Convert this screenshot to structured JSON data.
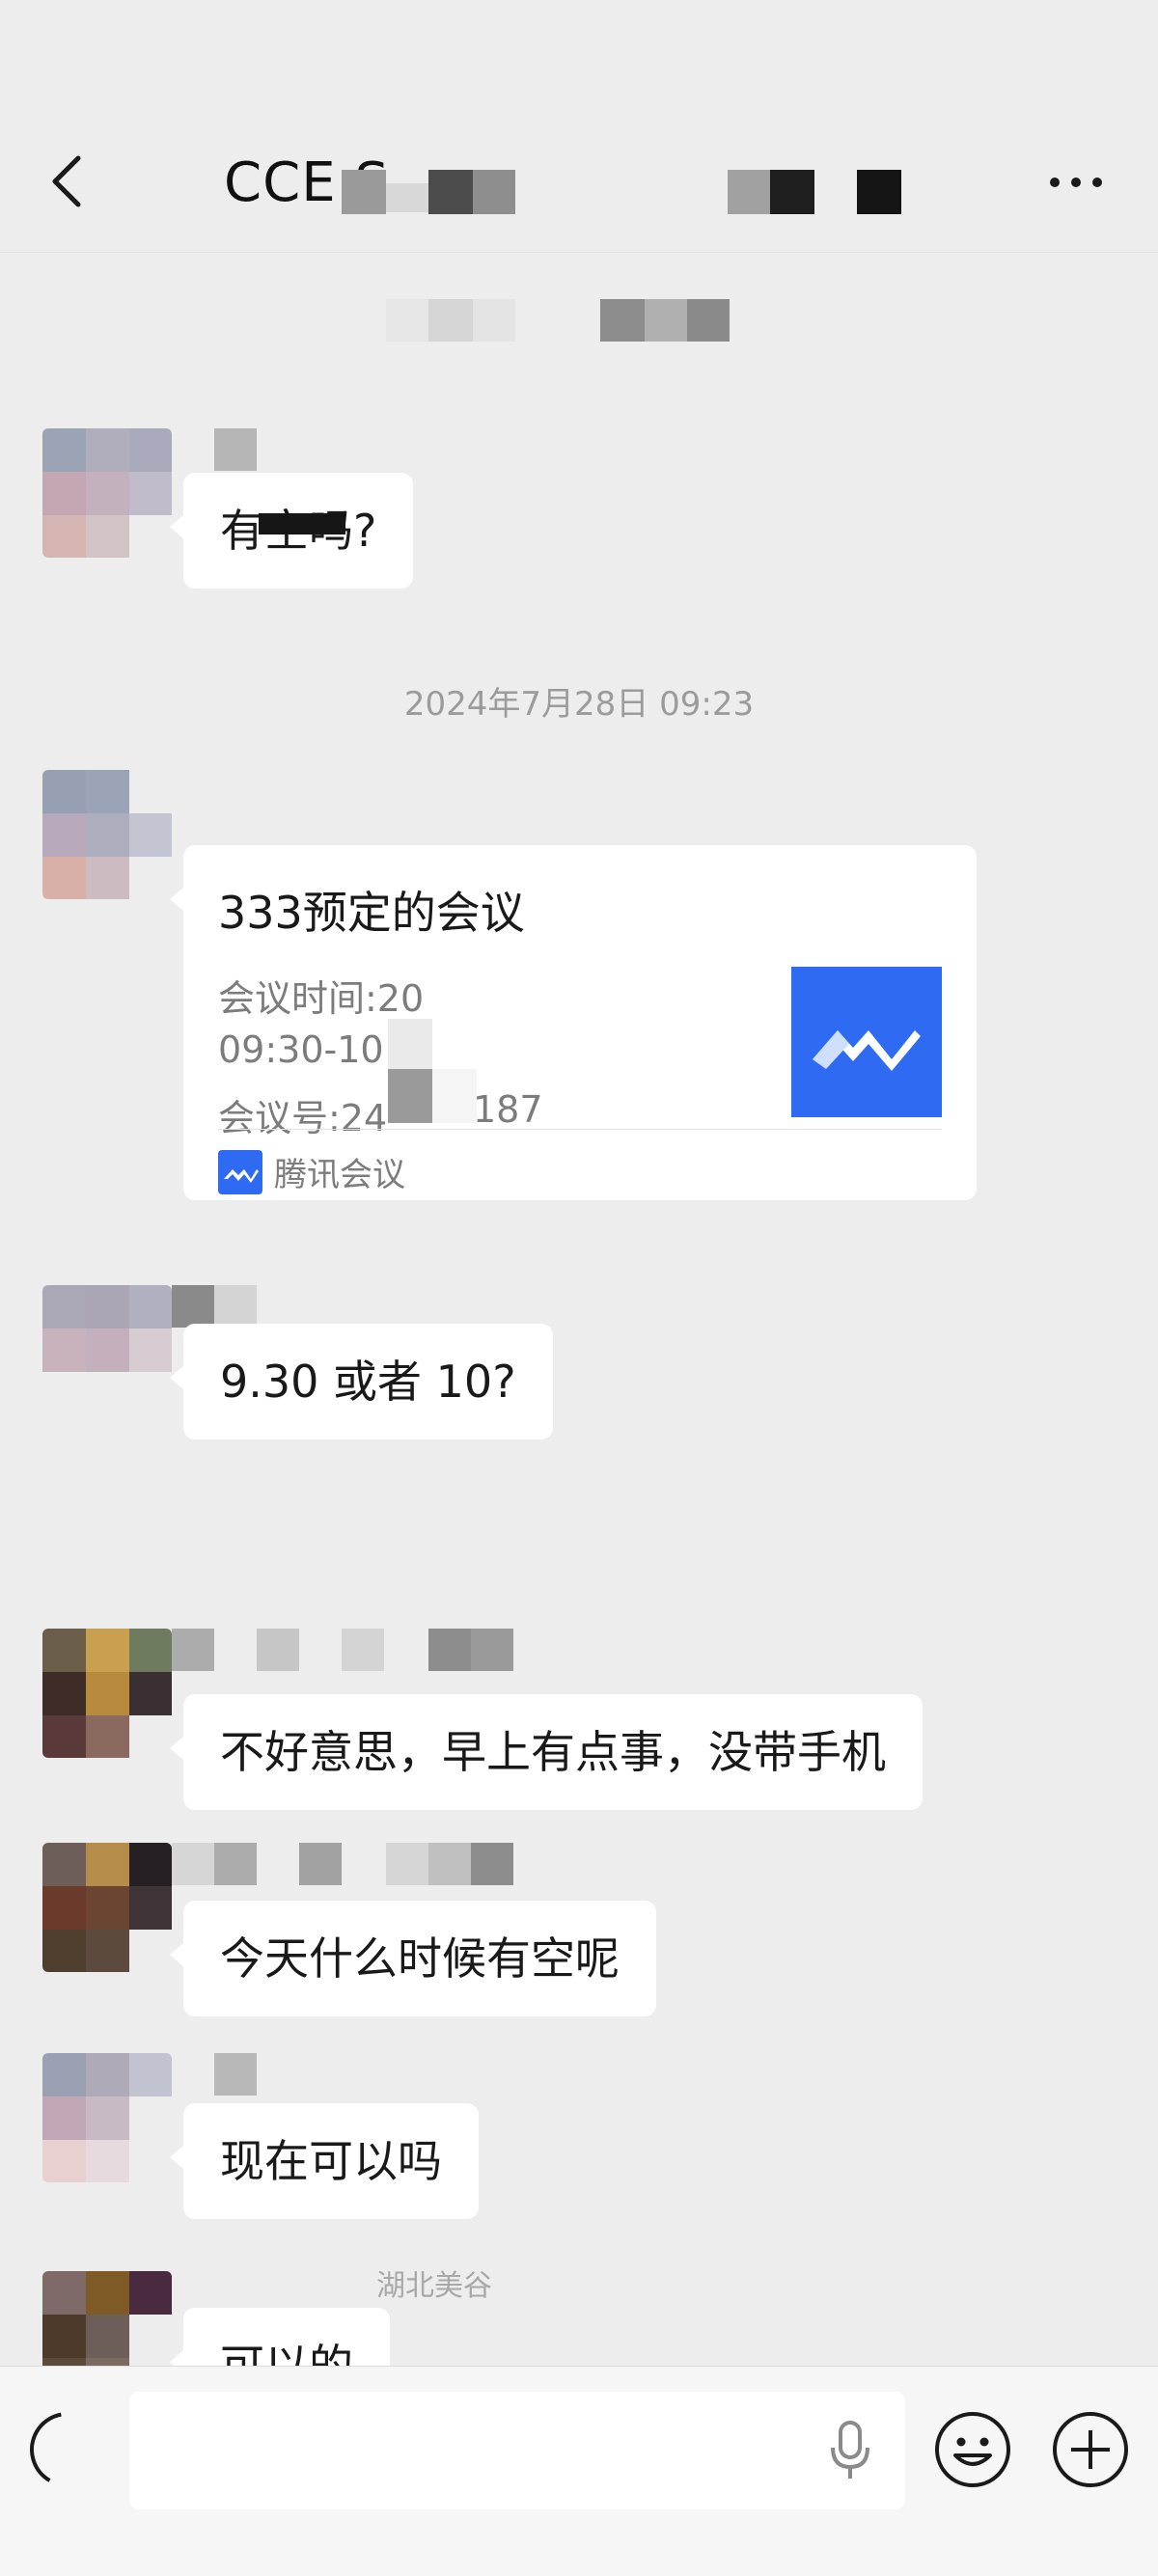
{
  "header": {
    "back_icon": "chevron-left-icon",
    "title": "CCE S",
    "more_icon": "more-dots-icon"
  },
  "messages": [
    {
      "type": "text",
      "text": "有空吗?"
    },
    {
      "type": "timestamp",
      "text": "2024年7月28日 09:23"
    },
    {
      "type": "meeting_card",
      "title": "333预定的会议",
      "time_label": "会议时间:20",
      "time_value": "09:30-10",
      "id_label": "会议号:24",
      "id_suffix": "187",
      "source": "腾讯会议",
      "logo_icon": "tencent-meeting-logo-icon"
    },
    {
      "type": "text",
      "text": "9.30 或者 10?"
    },
    {
      "type": "text",
      "text": "不好意思，早上有点事，没带手机"
    },
    {
      "type": "text",
      "text": "今天什么时候有空呢"
    },
    {
      "type": "text",
      "text": "现在可以吗"
    },
    {
      "type": "text",
      "text": "可以的"
    }
  ],
  "partial_sender": "湖北美谷",
  "inputbar": {
    "voice_icon": "voice-icon",
    "input_value": "",
    "mic_icon": "mic-icon",
    "emoji_icon": "emoji-icon",
    "plus_icon": "plus-circle-icon"
  },
  "colors": {
    "background": "#ededed",
    "bubble": "#ffffff",
    "brand_blue": "#2f6bf2",
    "timestamp": "#9b9b9b"
  }
}
